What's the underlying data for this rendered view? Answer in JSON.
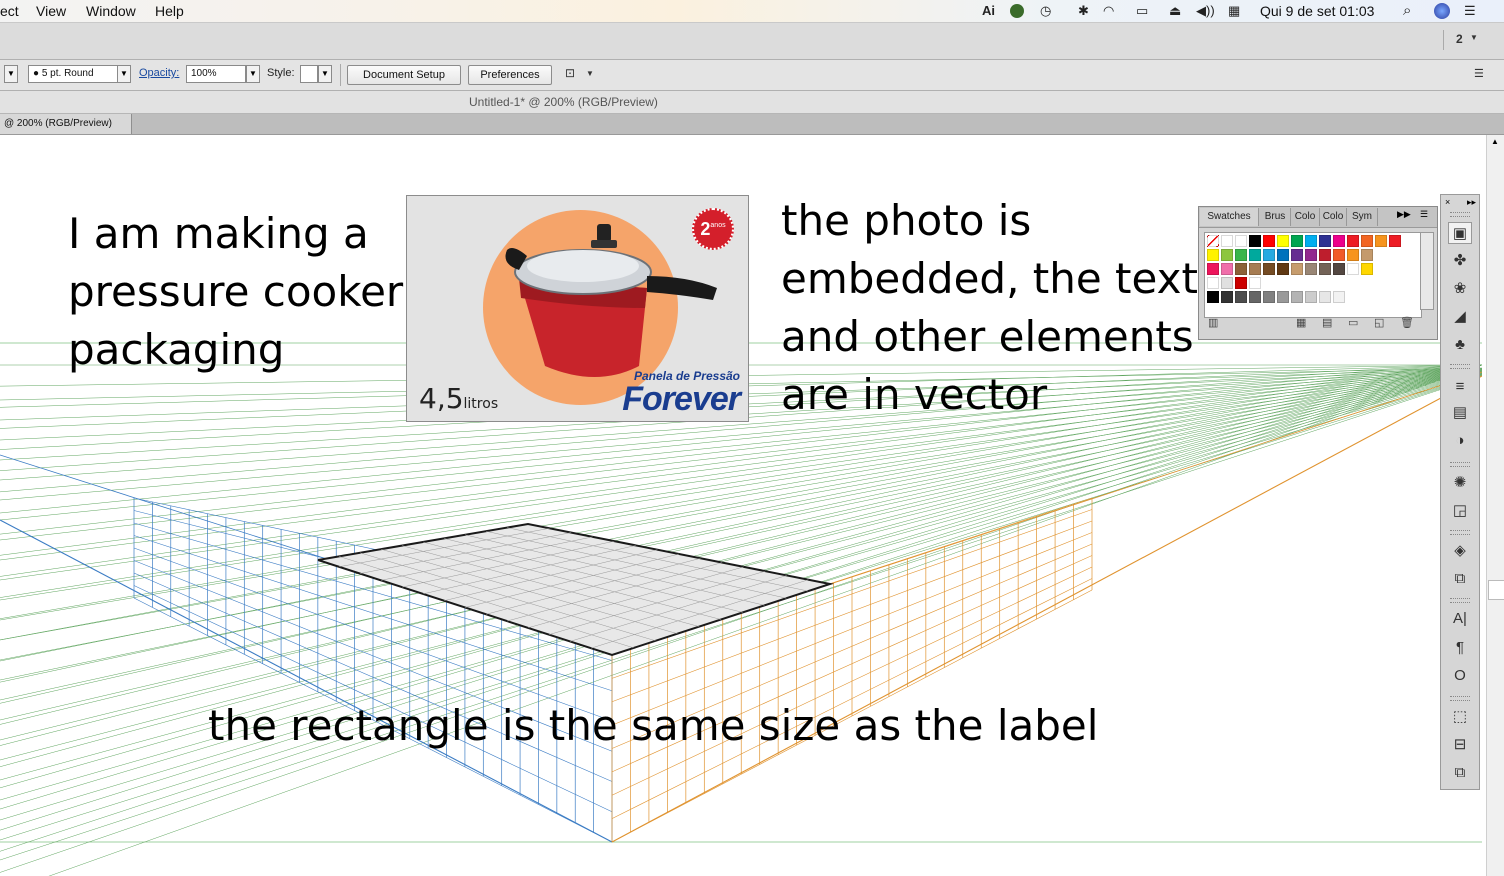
{
  "menubar": {
    "items": [
      "ect",
      "View",
      "Window",
      "Help"
    ],
    "status_icons": [
      "adobe-icon",
      "activity-icon",
      "time-machine-icon",
      "bluetooth-icon",
      "wifi-icon",
      "airplay-icon",
      "eject-icon",
      "volume-icon",
      "input-icon"
    ],
    "clock": "Qui 9 de set  01:03"
  },
  "appbar": {
    "workspace_number": "2"
  },
  "controlbar": {
    "stroke_profile": "5 pt. Round",
    "opacity_label": "Opacity:",
    "opacity_value": "100%",
    "style_label": "Style:",
    "document_setup": "Document Setup",
    "preferences": "Preferences"
  },
  "window": {
    "title": "Untitled-1* @ 200% (RGB/Preview)",
    "tab_label": "@ 200% (RGB/Preview)"
  },
  "annotations": {
    "left_lines": [
      "I am making a",
      "pressure cooker",
      "packaging"
    ],
    "right_lines": [
      "the photo is",
      "embedded, the text",
      "and other elements",
      "are in vector"
    ],
    "bottom": "the rectangle is the same size as the label"
  },
  "label_image": {
    "volume_number": "4,5",
    "volume_unit": "litros",
    "brand_line1": "Panela de Pressão",
    "brand_line2": "Forever",
    "badge_number": "2",
    "badge_text": "anos"
  },
  "swatches_panel": {
    "tabs": [
      "Swatches",
      "Brus",
      "Colo",
      "Colo",
      "Sym"
    ],
    "colors": [
      [
        "#ffffff",
        "#000000",
        "#ff0000",
        "#ffff00",
        "#00a651",
        "#00aeef",
        "#2e3192",
        "#ec008c",
        "#ed1c24",
        "#f26522",
        "#f7941d",
        "#ed1c24"
      ],
      [
        "#fff200",
        "#8dc63f",
        "#39b54a",
        "#00a99d",
        "#27aae1",
        "#0072bc",
        "#662d91",
        "#92278f",
        "#be1e2d",
        "#f15a29",
        "#f7941d",
        "#c49a6c"
      ],
      [
        "#ed145b",
        "#f06eaa",
        "#8c6239",
        "#a67c52",
        "#754c24",
        "#603913",
        "#c69c6d",
        "#998675",
        "#736357",
        "#534741",
        "#ffffff",
        "#ffd700"
      ],
      [
        "#ffffff",
        "#e0e0e0",
        "#cc0000",
        "#ffffff"
      ],
      [
        "#000000",
        "#333333",
        "#4d4d4d",
        "#666666",
        "#808080",
        "#999999",
        "#b3b3b3",
        "#cccccc",
        "#e6e6e6",
        "#f2f2f2"
      ]
    ]
  },
  "tools": [
    "swatch-libraries-icon",
    "symbol-sprayer-icon",
    "brush-icon",
    "gradient-icon",
    "club-icon",
    "stroke-icon",
    "gradient-panel-icon",
    "transparency-icon",
    "appearance-icon",
    "graphic-styles-icon",
    "layers-icon",
    "artboards-icon",
    "character-icon",
    "paragraph-icon",
    "opentype-icon",
    "transform-icon",
    "align-icon",
    "pathfinder-icon"
  ],
  "colors": {
    "left_grid": "#3b7cc4",
    "right_grid": "#e0932f",
    "ground_grid": "#5fa55f",
    "cooker_red": "#c8242b",
    "circle_orange": "#f5a46a",
    "brand_blue": "#1a3d8f"
  }
}
